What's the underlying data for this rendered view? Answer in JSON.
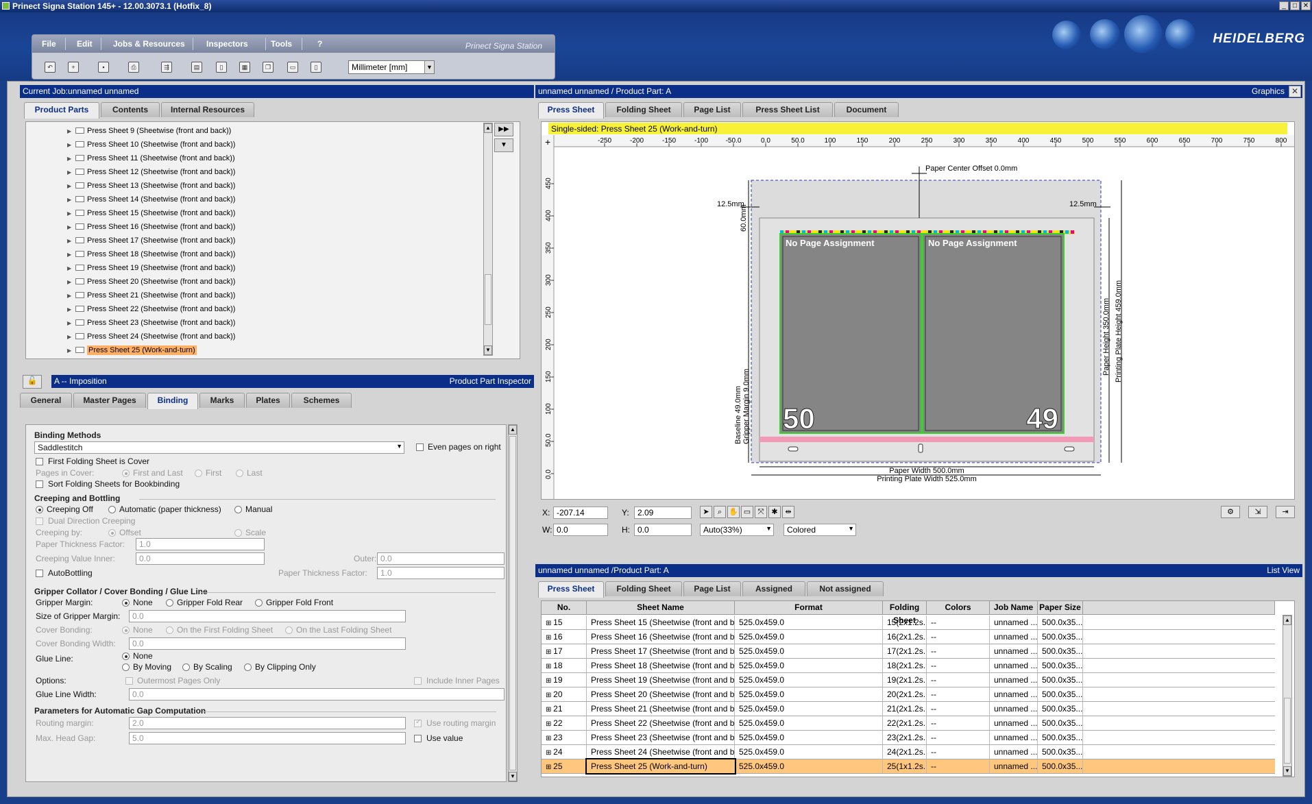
{
  "window": {
    "title": "Prinect Signa Station 145+  -  12.00.3073.1 (Hotfix_8)"
  },
  "menu": {
    "file": "File",
    "edit": "Edit",
    "jobs": "Jobs & Resources",
    "inspectors": "Inspectors",
    "tools": "Tools",
    "help": "?",
    "brand": "Prinect Signa Station",
    "unit": "Millimeter  [mm]"
  },
  "logo": "HEIDELBERG",
  "current_job": {
    "title": "Current Job:unnamed unnamed",
    "tabs": [
      "Product Parts",
      "Contents",
      "Internal Resources"
    ],
    "tree": [
      "Press Sheet 9 (Sheetwise (front and back))",
      "Press Sheet 10 (Sheetwise (front and back))",
      "Press Sheet 11 (Sheetwise (front and back))",
      "Press Sheet 12 (Sheetwise (front and back))",
      "Press Sheet 13 (Sheetwise (front and back))",
      "Press Sheet 14 (Sheetwise (front and back))",
      "Press Sheet 15 (Sheetwise (front and back))",
      "Press Sheet 16 (Sheetwise (front and back))",
      "Press Sheet 17 (Sheetwise (front and back))",
      "Press Sheet 18 (Sheetwise (front and back))",
      "Press Sheet 19 (Sheetwise (front and back))",
      "Press Sheet 20 (Sheetwise (front and back))",
      "Press Sheet 21 (Sheetwise (front and back))",
      "Press Sheet 22 (Sheetwise (front and back))",
      "Press Sheet 23 (Sheetwise (front and back))",
      "Press Sheet 24 (Sheetwise (front and back))",
      "Press Sheet 25 (Work-and-turn)"
    ],
    "selected_index": 16
  },
  "inspector": {
    "title": "A -- Imposition",
    "right": "Product Part Inspector",
    "tabs": [
      "General",
      "Master Pages",
      "Binding",
      "Marks",
      "Plates",
      "Schemes"
    ],
    "active_tab": "Binding",
    "binding_methods": "Binding Methods",
    "binding_method_value": "Saddlestitch",
    "even_pages_right": "Even pages on right",
    "first_folding_cover": "First Folding Sheet is Cover",
    "pages_in_cover": "Pages in Cover:",
    "first_and_last": "First and Last",
    "first": "First",
    "last": "Last",
    "sort_folding": "Sort Folding Sheets for Bookbinding",
    "creeping_and_bottling": "Creeping and Bottling",
    "creeping_off": "Creeping Off",
    "automatic": "Automatic (paper thickness)",
    "manual": "Manual",
    "dual_direction": "Dual Direction Creeping",
    "creeping_by": "Creeping by:",
    "offset": "Offset",
    "scale": "Scale",
    "paper_thickness_factor": "Paper Thickness Factor:",
    "paper_thickness_value": "1.0",
    "creeping_value_inner": "Creeping Value Inner:",
    "creeping_inner_value": "0.0",
    "outer": "Outer:",
    "outer_value": "0.0",
    "autobottling": "AutoBottling",
    "paper_thickness_factor2": "Paper Thickness Factor:",
    "paper_thickness_value2": "1.0",
    "gripper_section": "Gripper Collator / Cover Bonding / Glue Line",
    "gripper_margin": "Gripper Margin:",
    "none": "None",
    "gripper_fold_rear": "Gripper Fold Rear",
    "gripper_fold_front": "Gripper Fold Front",
    "size_gripper_margin": "Size of Gripper Margin:",
    "size_gripper_value": "0.0",
    "cover_bonding": "Cover Bonding:",
    "on_first_folding": "On the First Folding Sheet",
    "on_last_folding": "On the Last Folding Sheet",
    "cover_bonding_width": "Cover Bonding Width:",
    "cover_bonding_value": "0.0",
    "glue_line": "Glue Line:",
    "by_moving": "By Moving",
    "by_scaling": "By Scaling",
    "by_clipping": "By Clipping Only",
    "options": "Options:",
    "outermost_pages": "Outermost Pages Only",
    "include_inner": "Include Inner Pages",
    "glue_line_width": "Glue Line Width:",
    "glue_line_value": "0.0",
    "gap_section": "Parameters for Automatic Gap Computation",
    "routing_margin": "Routing margin:",
    "routing_value": "2.0",
    "use_routing_margin": "Use routing margin",
    "max_head_gap": "Max. Head Gap:",
    "max_head_value": "5.0",
    "use_value": "Use value"
  },
  "graphics": {
    "title": "unnamed unnamed  / Product Part: A",
    "right": "Graphics",
    "tabs": [
      "Press Sheet",
      "Folding Sheet",
      "Page List",
      "Press Sheet List",
      "Document"
    ],
    "banner": "Single-sided:  Press Sheet 25 (Work-and-turn)",
    "ruler_x": [
      "-250",
      "-200",
      "-150",
      "-100",
      "-50.0",
      "0.0",
      "50.0",
      "100",
      "150",
      "200",
      "250",
      "300",
      "350",
      "400",
      "450",
      "500",
      "550",
      "600",
      "650",
      "700",
      "750",
      "800"
    ],
    "ruler_y": [
      "450",
      "400",
      "350",
      "300",
      "250",
      "200",
      "150",
      "100",
      "50.0",
      "0.0"
    ],
    "paper_center_offset": "Paper Center Offset 0.0mm",
    "margin_left": "12.5mm",
    "margin_right": "12.5mm",
    "dim_60": "60.0mm",
    "page_left_label": "No Page Assignment",
    "page_right_label": "No Page Assignment",
    "page_left_num": "50",
    "page_right_num": "49",
    "paper_height": "Paper Height 350.0mm",
    "plate_height": "Printing Plate Height 459.0mm",
    "baseline": "Baseline 49.0mm",
    "gripper_margin": "Gripper Margin 9.0mm",
    "paper_width": "Paper Width 500.0mm",
    "plate_width": "Printing Plate Width 525.0mm",
    "x_label": "X:",
    "x_value": "-207.14",
    "y_label": "Y:",
    "y_value": "2.09",
    "w_label": "W:",
    "w_value": "0.0",
    "h_label": "H:",
    "h_value": "0.0",
    "zoom": "Auto(33%)",
    "color_mode": "Colored"
  },
  "list": {
    "title": "unnamed unnamed /Product Part: A",
    "right": "List View",
    "tabs": [
      "Press Sheet",
      "Folding Sheet",
      "Page List",
      "Assigned",
      "Not assigned"
    ],
    "headers": [
      "No.",
      "Sheet Name",
      "Format",
      "Folding Sheet",
      "Colors",
      "Job Name",
      "Paper Size"
    ],
    "rows": [
      [
        "15",
        "Press Sheet 15 (Sheetwise (front and back))",
        "525.0x459.0",
        "15(2x1.2s...",
        "--",
        "unnamed ...",
        "500.0x35..."
      ],
      [
        "16",
        "Press Sheet 16 (Sheetwise (front and back))",
        "525.0x459.0",
        "16(2x1.2s...",
        "--",
        "unnamed ...",
        "500.0x35..."
      ],
      [
        "17",
        "Press Sheet 17 (Sheetwise (front and back))",
        "525.0x459.0",
        "17(2x1.2s...",
        "--",
        "unnamed ...",
        "500.0x35..."
      ],
      [
        "18",
        "Press Sheet 18 (Sheetwise (front and back))",
        "525.0x459.0",
        "18(2x1.2s...",
        "--",
        "unnamed ...",
        "500.0x35..."
      ],
      [
        "19",
        "Press Sheet 19 (Sheetwise (front and back))",
        "525.0x459.0",
        "19(2x1.2s...",
        "--",
        "unnamed ...",
        "500.0x35..."
      ],
      [
        "20",
        "Press Sheet 20 (Sheetwise (front and back))",
        "525.0x459.0",
        "20(2x1.2s...",
        "--",
        "unnamed ...",
        "500.0x35..."
      ],
      [
        "21",
        "Press Sheet 21 (Sheetwise (front and back))",
        "525.0x459.0",
        "21(2x1.2s...",
        "--",
        "unnamed ...",
        "500.0x35..."
      ],
      [
        "22",
        "Press Sheet 22 (Sheetwise (front and back))",
        "525.0x459.0",
        "22(2x1.2s...",
        "--",
        "unnamed ...",
        "500.0x35..."
      ],
      [
        "23",
        "Press Sheet 23 (Sheetwise (front and back))",
        "525.0x459.0",
        "23(2x1.2s...",
        "--",
        "unnamed ...",
        "500.0x35..."
      ],
      [
        "24",
        "Press Sheet 24 (Sheetwise (front and back))",
        "525.0x459.0",
        "24(2x1.2s...",
        "--",
        "unnamed ...",
        "500.0x35..."
      ],
      [
        "25",
        "Press Sheet 25 (Work-and-turn)",
        "525.0x459.0",
        "25(1x1.2s...",
        "--",
        "unnamed ...",
        "500.0x35..."
      ]
    ],
    "selected_index": 10
  },
  "colors": {
    "panel_header": "#0b2e88",
    "selection": "#ffb064",
    "banner": "#f7f13a",
    "page_fill": "#858585",
    "page_frame": "#3bd12c"
  }
}
